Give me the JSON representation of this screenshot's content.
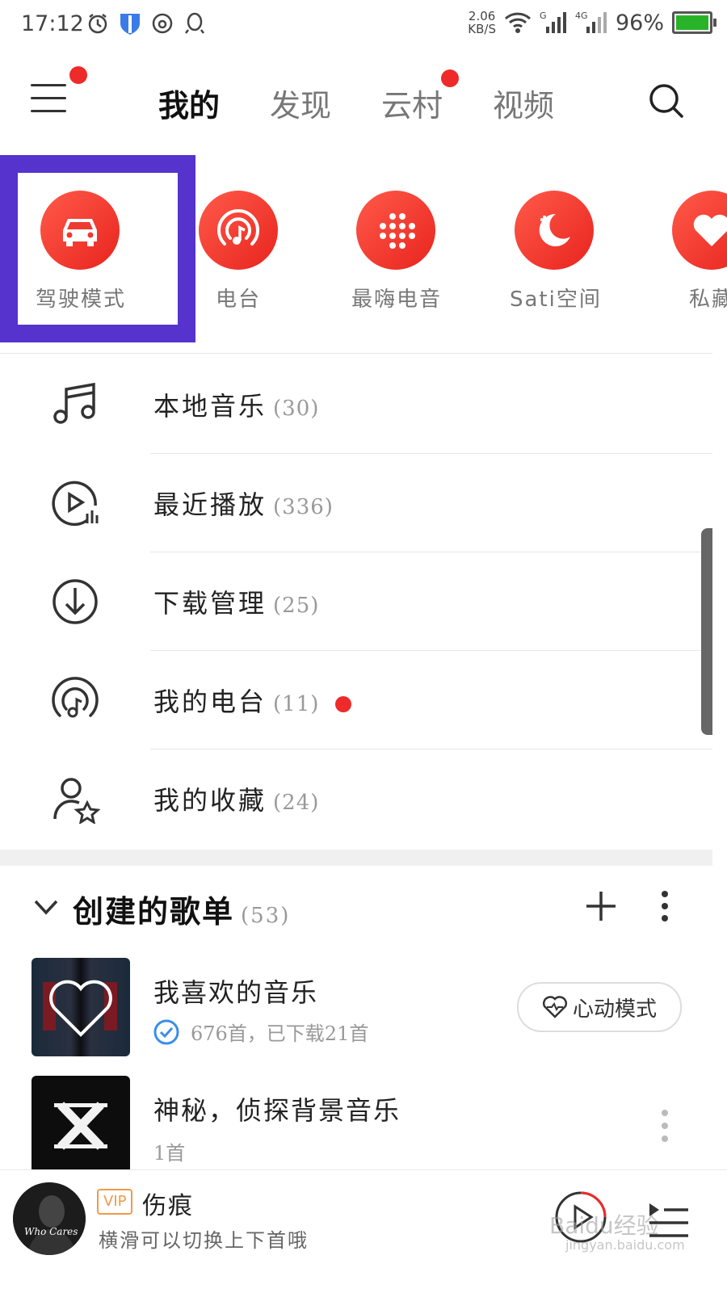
{
  "status_bar": {
    "time": "17:12",
    "net_speed_value": "2.06",
    "net_speed_unit": "KB/S",
    "battery_pct": "96%",
    "battery_level": 0.96,
    "battery_color": "#29b329",
    "signal_1_label": "G",
    "signal_2_label": "4G",
    "icons": [
      "alarm-icon",
      "shield-icon",
      "netease-icon",
      "qq-icon",
      "wifi-icon",
      "signal-icon",
      "battery-icon"
    ]
  },
  "nav": {
    "tabs": [
      {
        "label": "我的",
        "active": true
      },
      {
        "label": "发现",
        "active": false
      },
      {
        "label": "云村",
        "active": false
      },
      {
        "label": "视频",
        "active": false
      }
    ],
    "accent_color": "#ee2a2a"
  },
  "quick_icons": [
    {
      "label": "驾驶模式",
      "icon": "car-icon"
    },
    {
      "label": "电台",
      "icon": "radio-icon"
    },
    {
      "label": "最嗨电音",
      "icon": "dots-grid-icon"
    },
    {
      "label": "Sati空间",
      "icon": "moon-icon"
    },
    {
      "label": "私藏",
      "icon": "heart-icon"
    }
  ],
  "list": [
    {
      "label": "本地音乐",
      "count": "(30)",
      "icon": "music-note-icon"
    },
    {
      "label": "最近播放",
      "count": "(336)",
      "icon": "recent-play-icon"
    },
    {
      "label": "下载管理",
      "count": "(25)",
      "icon": "download-icon"
    },
    {
      "label": "我的电台",
      "count": "(11)",
      "icon": "my-radio-icon",
      "has_dot": true
    },
    {
      "label": "我的收藏",
      "count": "(24)",
      "icon": "user-star-icon"
    }
  ],
  "playlists": {
    "title": "创建的歌单",
    "count": "(53)",
    "items": [
      {
        "title": "我喜欢的音乐",
        "subtitle": "676首，已下载21首",
        "action": "心动模式"
      },
      {
        "title": "神秘，侦探背景音乐",
        "subtitle": "1首"
      }
    ]
  },
  "player": {
    "vip": "VIP",
    "song": "伤痕",
    "hint": "横滑可以切换上下首哦",
    "cover_text": "Who Cares"
  },
  "watermark": {
    "main": "Baidu经验",
    "sub": "jingyan.baidu.com"
  }
}
